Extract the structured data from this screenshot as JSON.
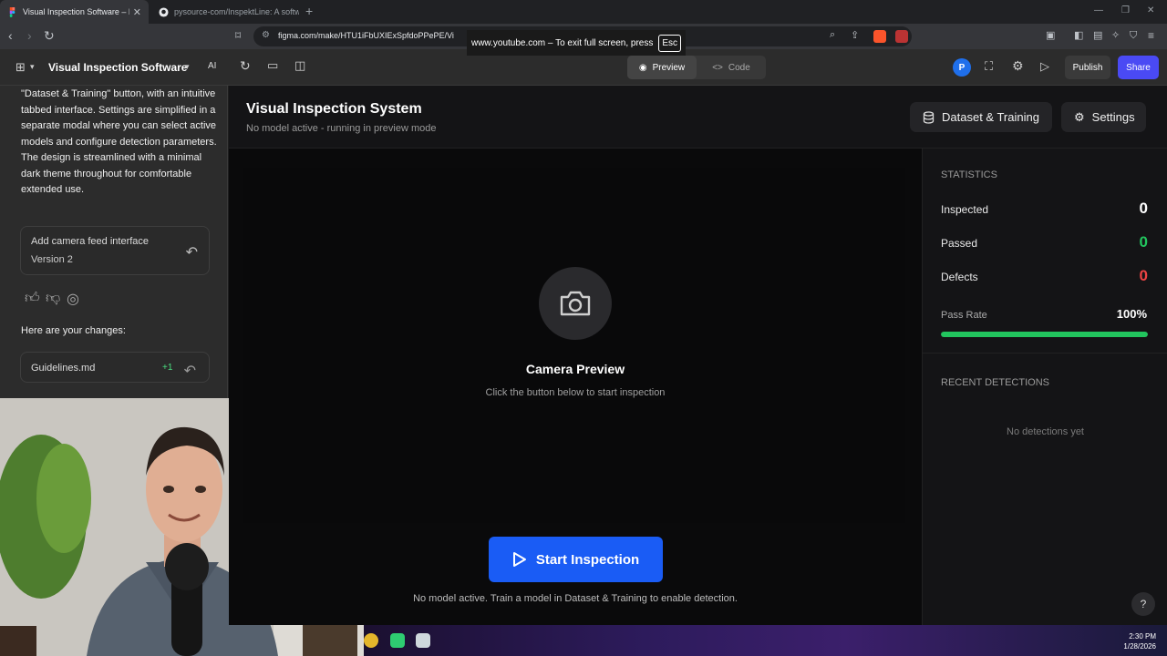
{
  "browser": {
    "tabs": [
      {
        "title": "Visual Inspection Software – Fig",
        "active": true
      },
      {
        "title": "pysource-com/InspektLine: A softw",
        "active": false
      }
    ],
    "url": "figma.com/make/HTU1iFbUXIExSpfdoPPePE/Vi",
    "fullscreen_toast": "www.youtube.com – To exit full screen, press",
    "fullscreen_key": "Esc"
  },
  "figma": {
    "file_title": "Visual Inspection Software",
    "ai_label": "AI",
    "preview_label": "Preview",
    "code_label": "Code",
    "avatar_initial": "P",
    "publish_label": "Publish",
    "share_label": "Share"
  },
  "chat": {
    "message": "\"Dataset & Training\" button, with an intuitive tabbed interface. Settings are simplified in a separate modal where you can select active models and configure detection parameters. The design is streamlined with a minimal dark theme throughout for comfortable extended use.",
    "version_title": "Add camera feed interface",
    "version_sub": "Version 2",
    "changes_label": "Here are your changes:",
    "file_name": "Guidelines.md",
    "file_diff": "+1"
  },
  "app": {
    "title": "Visual Inspection System",
    "subtitle": "No model active - running in preview mode",
    "dataset_button": "Dataset & Training",
    "settings_button": "Settings",
    "camera_title": "Camera Preview",
    "camera_sub": "Click the button below to start inspection",
    "start_button": "Start Inspection",
    "model_note": "No model active. Train a model in Dataset & Training to enable detection.",
    "stats": {
      "heading": "STATISTICS",
      "inspected_label": "Inspected",
      "inspected_value": "0",
      "passed_label": "Passed",
      "passed_value": "0",
      "defects_label": "Defects",
      "defects_value": "0",
      "pass_rate_label": "Pass Rate",
      "pass_rate_value": "100%",
      "pass_rate_fraction": 1.0
    },
    "recent": {
      "heading": "RECENT DETECTIONS",
      "empty": "No detections yet"
    },
    "help": "?"
  },
  "taskbar": {
    "time": "2:30 PM",
    "date": "1/28/2026"
  },
  "colors": {
    "accent_blue": "#1a5cf5",
    "share_purple": "#4a4af4",
    "passed_green": "#22c55e",
    "defects_red": "#ef4444"
  }
}
